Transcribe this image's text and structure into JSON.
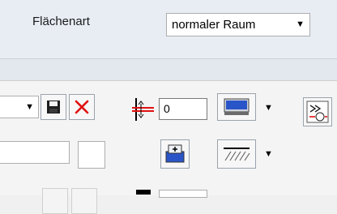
{
  "properties": {
    "area_type_label": "Flächenart",
    "area_type_value": "normaler Raum"
  },
  "toolbar": {
    "offset_value": "0"
  }
}
